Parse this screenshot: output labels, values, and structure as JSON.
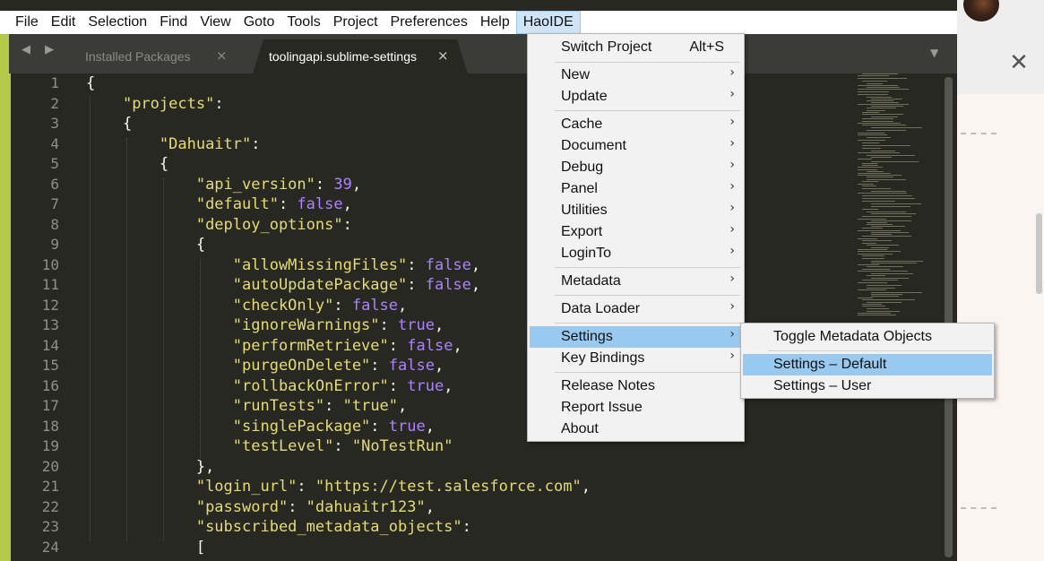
{
  "menubar": {
    "items": [
      "File",
      "Edit",
      "Selection",
      "Find",
      "View",
      "Goto",
      "Tools",
      "Project",
      "Preferences",
      "Help",
      "HaoIDE"
    ]
  },
  "tabs": {
    "nav": "◀ ▶",
    "items": [
      {
        "label": "Installed Packages",
        "close": "×"
      },
      {
        "label": "toolingapi.sublime-settings",
        "close": "×"
      }
    ],
    "dropdown_icon": "▼"
  },
  "haoide_menu": {
    "switch_project": {
      "label": "Switch Project",
      "shortcut": "Alt+S"
    },
    "items": [
      {
        "label": "New",
        "arrow": "›"
      },
      {
        "label": "Update",
        "arrow": "›"
      },
      {
        "label": "Cache",
        "arrow": "›"
      },
      {
        "label": "Document",
        "arrow": "›"
      },
      {
        "label": "Debug",
        "arrow": "›"
      },
      {
        "label": "Panel",
        "arrow": "›"
      },
      {
        "label": "Utilities",
        "arrow": "›"
      },
      {
        "label": "Export",
        "arrow": "›"
      },
      {
        "label": "LoginTo",
        "arrow": "›"
      },
      {
        "label": "Metadata",
        "arrow": "›"
      },
      {
        "label": "Data Loader",
        "arrow": "›"
      },
      {
        "label": "Settings",
        "arrow": "›"
      },
      {
        "label": "Key Bindings",
        "arrow": "›"
      },
      {
        "label": "Release Notes",
        "arrow": ""
      },
      {
        "label": "Report Issue",
        "arrow": ""
      },
      {
        "label": "About",
        "arrow": ""
      }
    ]
  },
  "settings_submenu": {
    "items": [
      "Toggle Metadata Objects",
      "Settings – Default",
      "Settings – User"
    ]
  },
  "editor": {
    "line_numbers": [
      "1",
      "2",
      "3",
      "4",
      "5",
      "6",
      "7",
      "8",
      "9",
      "10",
      "11",
      "12",
      "13",
      "14",
      "15",
      "16",
      "17",
      "18",
      "19",
      "20",
      "21",
      "22",
      "23",
      "24"
    ],
    "lines": [
      [
        [
          "p",
          "{"
        ]
      ],
      [
        [
          "p",
          "    "
        ],
        [
          "s",
          "\"projects\""
        ],
        [
          "p",
          ":"
        ]
      ],
      [
        [
          "p",
          "    {"
        ]
      ],
      [
        [
          "p",
          "        "
        ],
        [
          "s",
          "\"Dahuaitr\""
        ],
        [
          "p",
          ":"
        ]
      ],
      [
        [
          "p",
          "        {"
        ]
      ],
      [
        [
          "p",
          "            "
        ],
        [
          "s",
          "\"api_version\""
        ],
        [
          "p",
          ": "
        ],
        [
          "n",
          "39"
        ],
        [
          "p",
          ","
        ]
      ],
      [
        [
          "p",
          "            "
        ],
        [
          "s",
          "\"default\""
        ],
        [
          "p",
          ": "
        ],
        [
          "b",
          "false"
        ],
        [
          "p",
          ","
        ]
      ],
      [
        [
          "p",
          "            "
        ],
        [
          "s",
          "\"deploy_options\""
        ],
        [
          "p",
          ":"
        ]
      ],
      [
        [
          "p",
          "            {"
        ]
      ],
      [
        [
          "p",
          "                "
        ],
        [
          "s",
          "\"allowMissingFiles\""
        ],
        [
          "p",
          ": "
        ],
        [
          "b",
          "false"
        ],
        [
          "p",
          ","
        ]
      ],
      [
        [
          "p",
          "                "
        ],
        [
          "s",
          "\"autoUpdatePackage\""
        ],
        [
          "p",
          ": "
        ],
        [
          "b",
          "false"
        ],
        [
          "p",
          ","
        ]
      ],
      [
        [
          "p",
          "                "
        ],
        [
          "s",
          "\"checkOnly\""
        ],
        [
          "p",
          ": "
        ],
        [
          "b",
          "false"
        ],
        [
          "p",
          ","
        ]
      ],
      [
        [
          "p",
          "                "
        ],
        [
          "s",
          "\"ignoreWarnings\""
        ],
        [
          "p",
          ": "
        ],
        [
          "b",
          "true"
        ],
        [
          "p",
          ","
        ]
      ],
      [
        [
          "p",
          "                "
        ],
        [
          "s",
          "\"performRetrieve\""
        ],
        [
          "p",
          ": "
        ],
        [
          "b",
          "false"
        ],
        [
          "p",
          ","
        ]
      ],
      [
        [
          "p",
          "                "
        ],
        [
          "s",
          "\"purgeOnDelete\""
        ],
        [
          "p",
          ": "
        ],
        [
          "b",
          "false"
        ],
        [
          "p",
          ","
        ]
      ],
      [
        [
          "p",
          "                "
        ],
        [
          "s",
          "\"rollbackOnError\""
        ],
        [
          "p",
          ": "
        ],
        [
          "b",
          "true"
        ],
        [
          "p",
          ","
        ]
      ],
      [
        [
          "p",
          "                "
        ],
        [
          "s",
          "\"runTests\""
        ],
        [
          "p",
          ": "
        ],
        [
          "s",
          "\"true\""
        ],
        [
          "p",
          ","
        ]
      ],
      [
        [
          "p",
          "                "
        ],
        [
          "s",
          "\"singlePackage\""
        ],
        [
          "p",
          ": "
        ],
        [
          "b",
          "true"
        ],
        [
          "p",
          ","
        ]
      ],
      [
        [
          "p",
          "                "
        ],
        [
          "s",
          "\"testLevel\""
        ],
        [
          "p",
          ": "
        ],
        [
          "s",
          "\"NoTestRun\""
        ]
      ],
      [
        [
          "p",
          "            },"
        ]
      ],
      [
        [
          "p",
          "            "
        ],
        [
          "s",
          "\"login_url\""
        ],
        [
          "p",
          ": "
        ],
        [
          "s",
          "\"https://test.salesforce.com\""
        ],
        [
          "p",
          ","
        ]
      ],
      [
        [
          "p",
          "            "
        ],
        [
          "s",
          "\"password\""
        ],
        [
          "p",
          ": "
        ],
        [
          "s",
          "\"dahuaitr123\""
        ],
        [
          "p",
          ","
        ]
      ],
      [
        [
          "p",
          "            "
        ],
        [
          "s",
          "\"subscribed_metadata_objects\""
        ],
        [
          "p",
          ":"
        ]
      ],
      [
        [
          "p",
          "            ["
        ]
      ]
    ]
  },
  "background": {
    "close_icon": "✕"
  },
  "colors": {
    "editor_bg": "#272822",
    "string": "#e6db74",
    "constant": "#ae81ff",
    "menu_highlight": "#99c9ef",
    "accent_edge": "#b2c94a"
  }
}
